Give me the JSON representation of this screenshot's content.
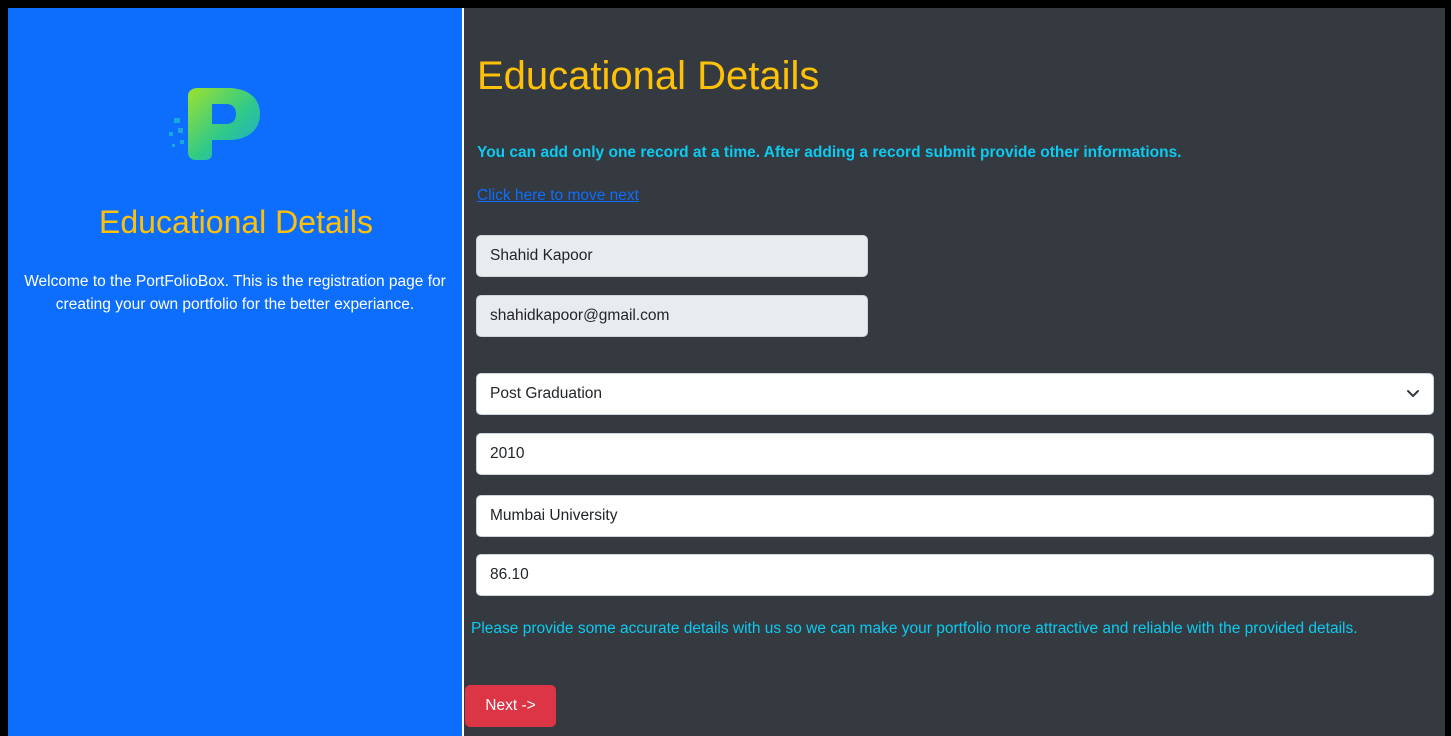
{
  "sidebar": {
    "title": "Educational Details",
    "welcome_text": "Welcome to the PortFolioBox. This is the registration page for creating your own portfolio for the better experiance."
  },
  "main": {
    "title": "Educational Details",
    "notice": "You can add only one record at a time. After adding a record submit provide other informations.",
    "next_link": "Click here to move next",
    "fields": {
      "name": "Shahid Kapoor",
      "email": "shahidkapoor@gmail.com",
      "qualification": "Post Graduation",
      "year": "2010",
      "university": "Mumbai University",
      "percentage": "86.10"
    },
    "help_text": "Please provide some accurate details with us so we can make your portfolio more attractive and reliable with the provided details.",
    "next_button": "Next ->"
  },
  "colors": {
    "sidebar_bg": "#0d6efd",
    "main_bg": "#343a40",
    "title": "#ffc107",
    "info_text": "#0dcaf0",
    "button": "#dc3545"
  },
  "icons": {
    "logo": "portfoliobox-p-logo",
    "dropdown": "chevron-down-icon"
  }
}
